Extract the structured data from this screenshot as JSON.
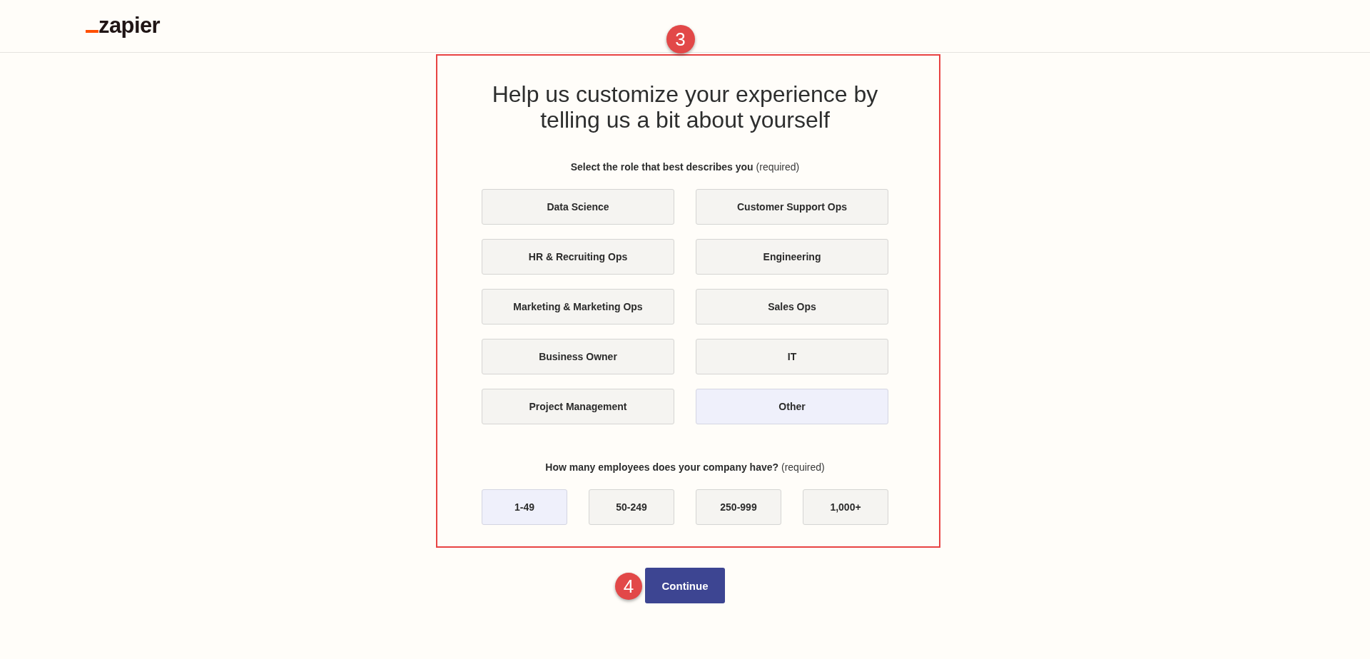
{
  "header": {
    "logo": "zapier"
  },
  "form": {
    "marker": "3",
    "title": "Help us customize your experience by telling us a bit about yourself",
    "role_question": "**Select the role that best describes you** (required)",
    "roles": [
      {
        "label": "Data Science",
        "selected": false
      },
      {
        "label": "Customer Support Ops",
        "selected": false
      },
      {
        "label": "HR & Recruiting Ops",
        "selected": false
      },
      {
        "label": "Engineering",
        "selected": false
      },
      {
        "label": "Marketing & Marketing Ops",
        "selected": false
      },
      {
        "label": "Sales Ops",
        "selected": false
      },
      {
        "label": "Business Owner",
        "selected": false
      },
      {
        "label": "IT",
        "selected": false
      },
      {
        "label": "Project Management",
        "selected": false
      },
      {
        "label": "Other",
        "selected": true
      }
    ],
    "employee_question": "**How many employees does your company have?** (required)",
    "employee_counts": [
      {
        "label": "1-49",
        "selected": true
      },
      {
        "label": "50-249",
        "selected": false
      },
      {
        "label": "250-999",
        "selected": false
      },
      {
        "label": "1,000+",
        "selected": false
      }
    ]
  },
  "continue_button": {
    "label": "Continue",
    "marker": "4"
  }
}
